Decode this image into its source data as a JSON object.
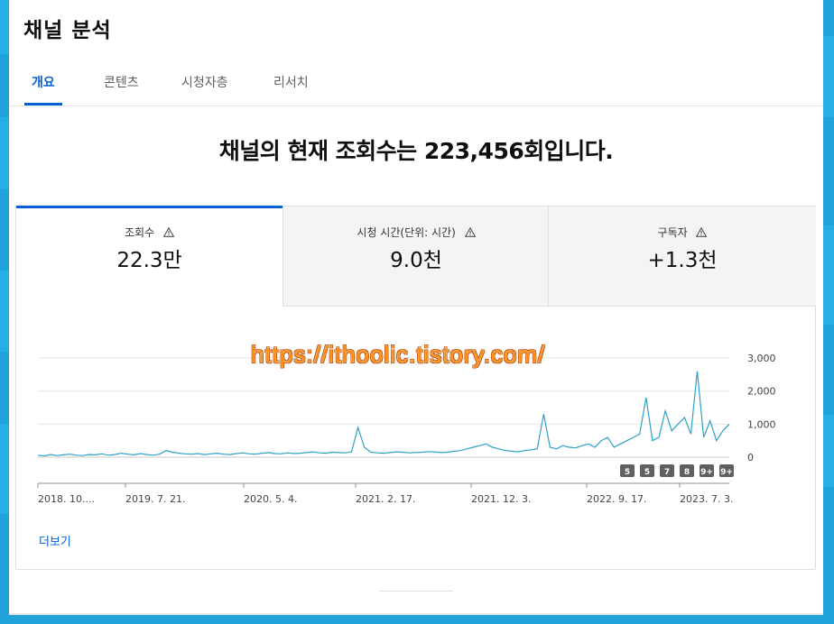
{
  "page": {
    "title": "채널 분석"
  },
  "tabs": [
    {
      "label": "개요",
      "active": true
    },
    {
      "label": "콘텐츠",
      "active": false
    },
    {
      "label": "시청자층",
      "active": false
    },
    {
      "label": "리서치",
      "active": false
    }
  ],
  "headline": "채널의 현재 조회수는 223,456회입니다.",
  "metrics": [
    {
      "label": "조회수",
      "value": "22.3만",
      "icon": "warning-icon"
    },
    {
      "label": "시청 시간(단위: 시간)",
      "value": "9.0천",
      "icon": "warning-icon"
    },
    {
      "label": "구독자",
      "value": "+1.3천",
      "icon": "warning-icon"
    }
  ],
  "watermark": "https://ithoolic.tistory.com/",
  "more_label": "더보기",
  "colors": {
    "accent": "#065fd4",
    "line": "#2fa1c6",
    "badge": "#606060"
  },
  "chart_data": {
    "type": "line",
    "x_tick_labels": [
      "2018. 10....",
      "2019. 7. 21.",
      "2020. 5. 4.",
      "2021. 2. 17.",
      "2021. 12. 3.",
      "2022. 9. 17.",
      "2023. 7. 3."
    ],
    "y_tick_labels": [
      "3,000",
      "2,000",
      "1,000",
      "0"
    ],
    "ylim": [
      0,
      3000
    ],
    "grid": true,
    "series": [
      {
        "values": [
          60,
          40,
          80,
          50,
          70,
          90,
          60,
          50,
          80,
          70,
          100,
          60,
          80,
          120,
          90,
          70,
          110,
          80,
          60,
          90,
          200,
          150,
          120,
          100,
          90,
          110,
          80,
          100,
          120,
          90,
          80,
          110,
          130,
          100,
          90,
          120,
          140,
          110,
          100,
          130,
          110,
          120,
          140,
          160,
          130,
          120,
          150,
          140,
          130,
          160,
          900,
          300,
          150,
          130,
          120,
          140,
          160,
          150,
          130,
          140,
          150,
          170,
          160,
          140,
          150,
          180,
          200,
          250,
          300,
          350,
          400,
          300,
          250,
          200,
          180,
          160,
          200,
          220,
          250,
          1300,
          300,
          250,
          350,
          300,
          280,
          350,
          400,
          300,
          500,
          600,
          300,
          400,
          500,
          600,
          700,
          1800,
          500,
          600,
          1400,
          800,
          1000,
          1200,
          700,
          2600,
          600,
          1100,
          500,
          800,
          1000
        ]
      }
    ],
    "badges": [
      "5",
      "5",
      "7",
      "8",
      "9+",
      "9+"
    ]
  }
}
